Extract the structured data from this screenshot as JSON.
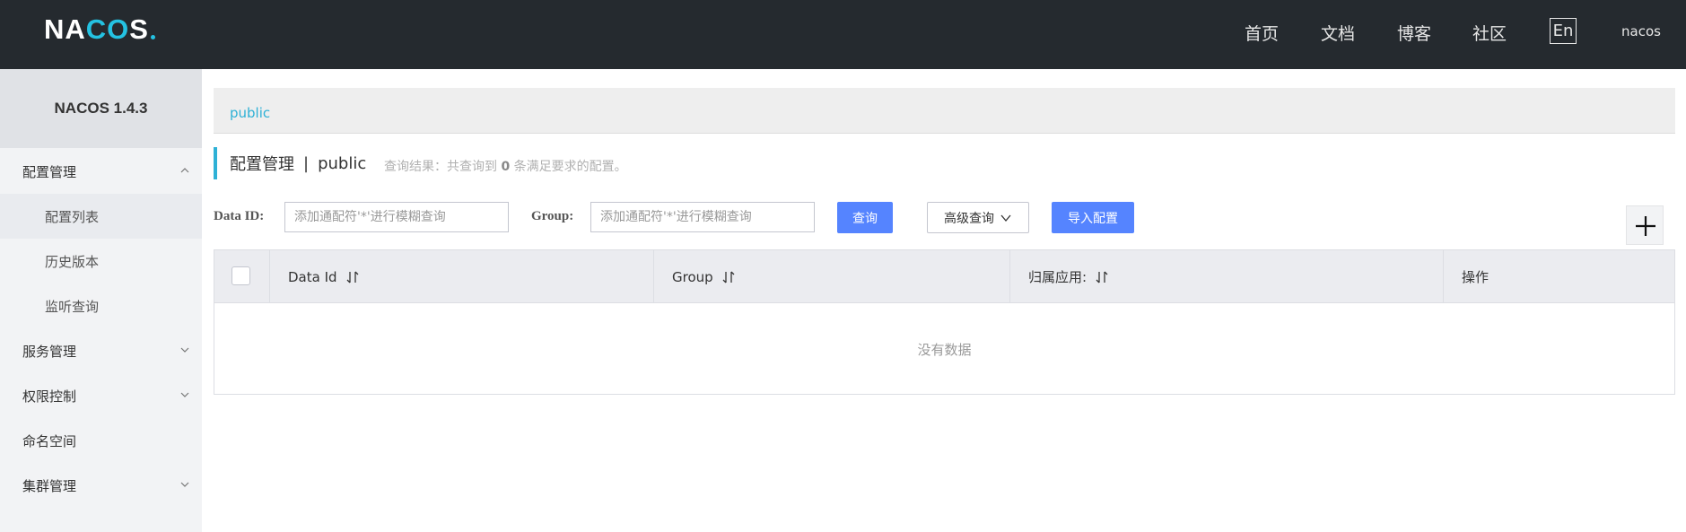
{
  "header": {
    "logo": {
      "part1": "NA",
      "part2": "CO",
      "part3": "S"
    },
    "nav": [
      "首页",
      "文档",
      "博客",
      "社区"
    ],
    "lang": "En",
    "user": "nacos"
  },
  "sidebar": {
    "title": "NACOS 1.4.3",
    "items": [
      {
        "label": "配置管理",
        "type": "group",
        "expanded": true
      },
      {
        "label": "配置列表",
        "type": "sub",
        "active": true
      },
      {
        "label": "历史版本",
        "type": "sub"
      },
      {
        "label": "监听查询",
        "type": "sub"
      },
      {
        "label": "服务管理",
        "type": "group",
        "expanded": false
      },
      {
        "label": "权限控制",
        "type": "group",
        "expanded": false
      },
      {
        "label": "命名空间",
        "type": "item"
      },
      {
        "label": "集群管理",
        "type": "group",
        "expanded": false
      }
    ]
  },
  "main": {
    "breadcrumb": "public",
    "title": "配置管理",
    "separator": "|",
    "namespace": "public",
    "query_result": {
      "prefix": "查询结果：共查询到",
      "count": "0",
      "suffix": "条满足要求的配置。"
    },
    "filters": {
      "data_id_label": "Data ID:",
      "data_id_placeholder": "添加通配符'*'进行模糊查询",
      "group_label": "Group:",
      "group_placeholder": "添加通配符'*'进行模糊查询",
      "search_button": "查询",
      "advanced_button": "高级查询",
      "import_button": "导入配置"
    },
    "table": {
      "columns": [
        "Data Id",
        "Group",
        "归属应用:",
        "操作"
      ],
      "empty_text": "没有数据"
    }
  },
  "colors": {
    "header_bg": "#252a2f",
    "accent": "#2eb1d6",
    "primary_button": "#5584ff"
  }
}
